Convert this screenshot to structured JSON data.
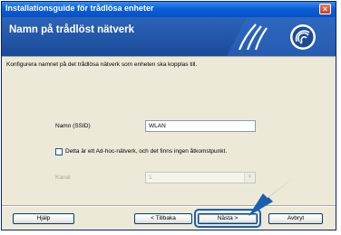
{
  "window": {
    "title": "Installationsguide för trådlösa enheter",
    "close_glyph": "×"
  },
  "banner": {
    "title": "Namn på trådlöst nätverk",
    "logo_icon": "wireless-signal-icon",
    "colors": {
      "banner": "#1b4a98",
      "logo": "#ffffff"
    }
  },
  "description": "Konfigurera namnet på det trådlösa nätverk som enheten ska kopplas till.",
  "ssid": {
    "label": "Namn (SSID)",
    "value": "WLAN"
  },
  "adhoc": {
    "label": "Detta är ett Ad-hoc-nätverk, och det finns ingen åtkomstpunkt.",
    "checked": false
  },
  "channel": {
    "label": "Kanal",
    "value": "1",
    "disabled": true
  },
  "buttons": {
    "help": "Hjälp",
    "back": "< Tillbaka",
    "next": "Nästa >",
    "cancel": "Avbryt"
  },
  "annotation": {
    "arrow_icon": "pointer-arrow-icon",
    "arrow_color": "#1a5fb0"
  }
}
